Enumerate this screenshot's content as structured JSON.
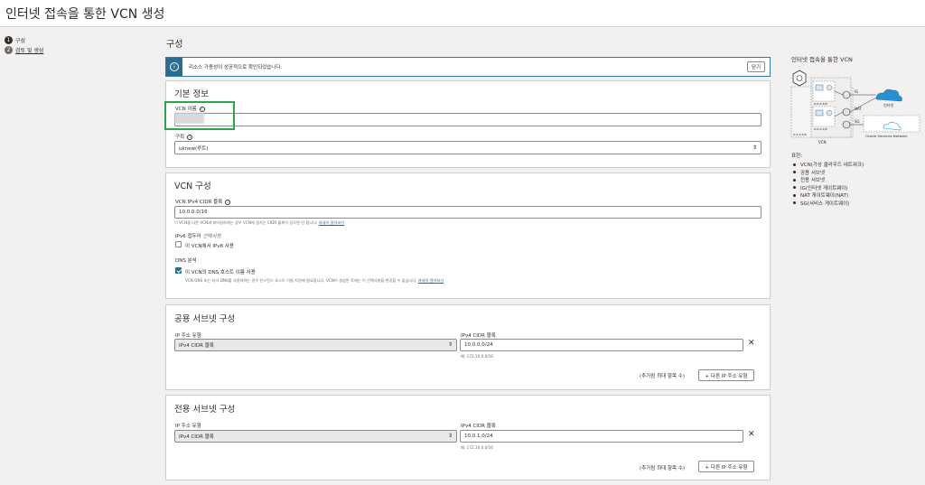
{
  "page": {
    "title": "인터넷 접속을 통한 VCN 생성"
  },
  "steps": [
    {
      "num": "1",
      "label": "구성"
    },
    {
      "num": "2",
      "label": "검토 및 생성"
    }
  ],
  "section_title": "구성",
  "banner": {
    "message": "리소스 가용성이 성공적으로 확인되었습니다.",
    "close_label": "닫기"
  },
  "basic": {
    "title": "기본 정보",
    "vcn_name_label": "VCN 이름",
    "vcn_name_value": "",
    "compartment_label": "구획",
    "compartment_value": "uknew(루트)"
  },
  "vcn_config": {
    "title": "VCN 구성",
    "cidr_label": "VCN IPv4 CIDR 블록",
    "cidr_value": "10.0.0.0/16",
    "cidr_hint": "이 VCN을 다른 VCN과 피어링하려는 경우 VCN에 겹치는 CIDR 블록이 있으면 안 됩니다.",
    "cidr_hint_link": "자세히 알아보기",
    "ipv6_label": "IPv6 접두어",
    "ipv6_optional": "선택사항",
    "ipv6_checkbox_label": "이 VCN에서 IPv6 사용",
    "dns_label": "DNS 분석",
    "dns_checkbox_label": "이 VCN의 DNS 호스트 이름 사용",
    "dns_hint": "VCN DNS 또는 타사 DNS를 사용하려는 경우 인스턴스 호스트 이름 지정에 필요합니다. VCN이 생성된 후에는 이 선택사항을 변경할 수 없습니다.",
    "dns_hint_link": "자세히 알아보기"
  },
  "public_subnet": {
    "title": "공용 서브넷 구성",
    "ip_type_label": "IP 주소 유형",
    "ip_type_value": "IPv4 CIDR 블록",
    "cidr_label": "IPv4 CIDR 블록",
    "cidr_value": "10.0.0.0/24",
    "example": "예: 172.16.0.0/16",
    "max_note": "(추가됨 최대 항목 수)",
    "add_button": "+ 다른 IP 주소 유형"
  },
  "private_subnet": {
    "title": "전용 서브넷 구성",
    "ip_type_label": "IP 주소 유형",
    "ip_type_value": "IPv4 CIDR 블록",
    "cidr_label": "IPv4 CIDR 블록",
    "cidr_value": "10.0.1.0/24",
    "example": "예: 172.16.0.0/16",
    "max_note": "(추가됨 최대 항목 수)",
    "add_button": "+ 다른 IP 주소 유형"
  },
  "side": {
    "title": "인터넷 접속을 통한 VCN",
    "diagram": {
      "ig": "IG",
      "nat": "NAT",
      "sg": "SG",
      "internet": "인터넷",
      "oracle_services": "Oracle Services Network",
      "vcn": "VCN",
      "cidr_a": "x.x.x.x/x",
      "cidr_b": "x.x.x.x/x",
      "cidr_c": "x.x.x.x/x"
    },
    "legend_title": "표현:",
    "legend": [
      "VCN(가상 클라우드 네트워크)",
      "공용 서브넷",
      "전용 서브넷",
      "IG(인터넷 게이트웨이)",
      "NAT 게이트웨이(NAT)",
      "SG(서비스 게이트웨이)"
    ]
  },
  "colors": {
    "accent": "#2a6d93",
    "highlight": "#2aa64a",
    "link": "#1b6ea3"
  }
}
